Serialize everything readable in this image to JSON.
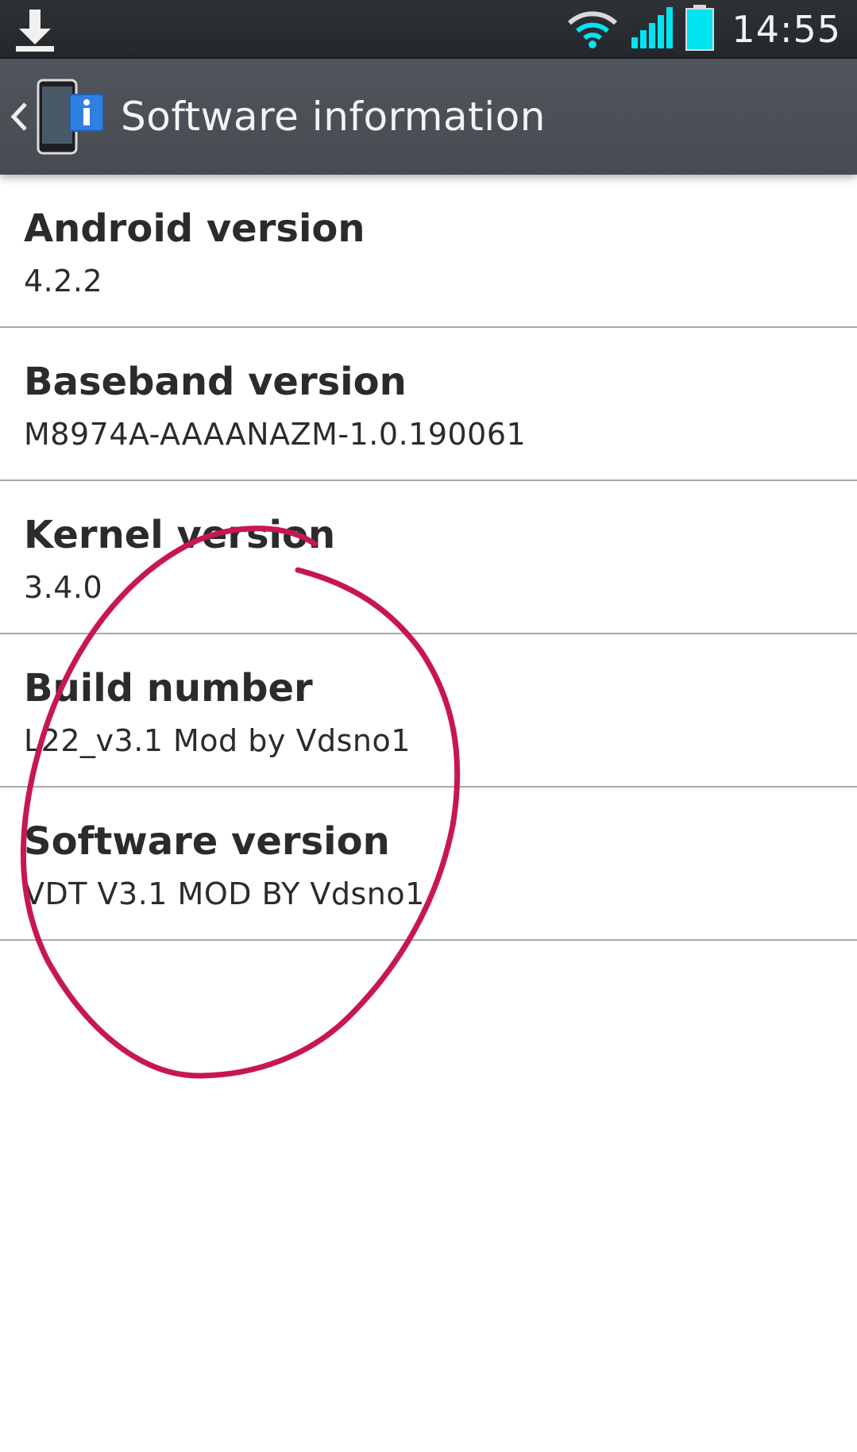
{
  "status_bar": {
    "time": "14:55",
    "icons": [
      "download-icon",
      "wifi-icon",
      "signal-icon",
      "battery-icon"
    ],
    "accent_color": "#00e5f0"
  },
  "action_bar": {
    "title": "Software information",
    "back_icon": "chevron-left-icon",
    "app_icon": "phone-info-icon"
  },
  "items": [
    {
      "title": "Android version",
      "value": "4.2.2"
    },
    {
      "title": "Baseband version",
      "value": "M8974A-AAAANAZM-1.0.190061"
    },
    {
      "title": "Kernel version",
      "value": "3.4.0"
    },
    {
      "title": "Build number",
      "value": "L22_v3.1 Mod by Vdsno1"
    },
    {
      "title": "Software version",
      "value": "VDT V3.1 MOD BY Vdsno1"
    }
  ],
  "annotation": {
    "shape": "hand-drawn-circle",
    "color": "#c8174f"
  }
}
